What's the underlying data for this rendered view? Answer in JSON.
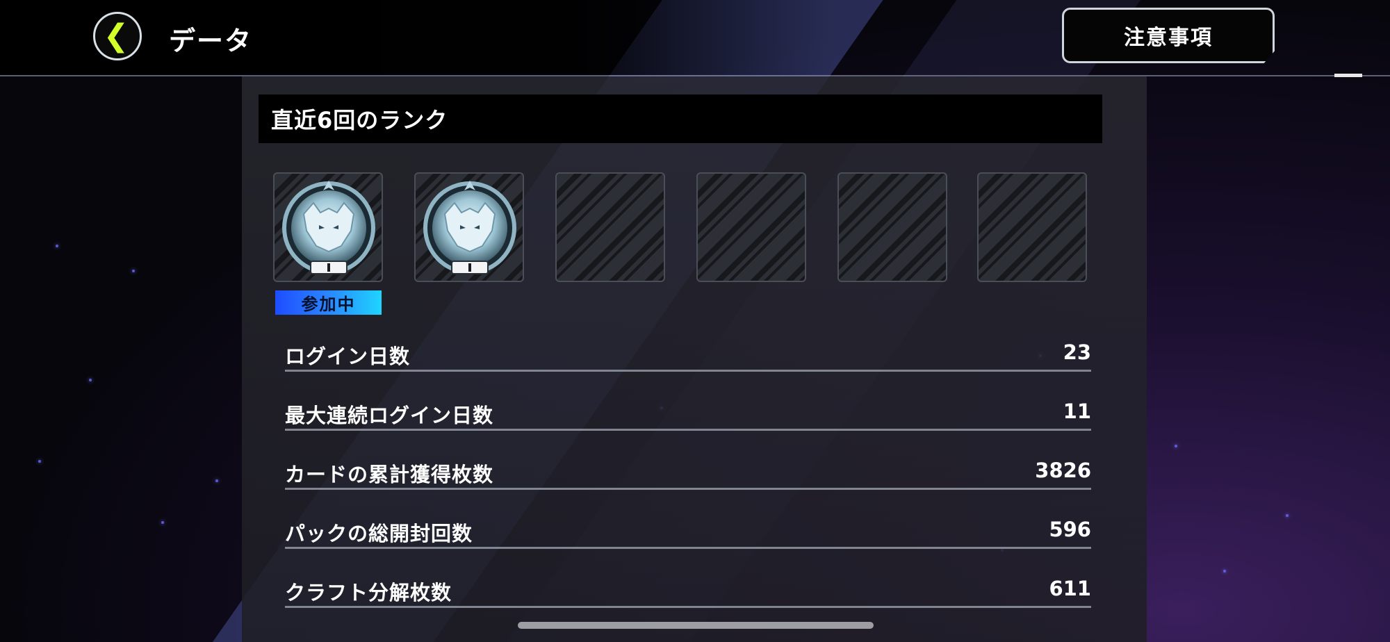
{
  "header": {
    "back_icon": "chevron-left-icon",
    "title": "データ",
    "notice_button": "注意事項"
  },
  "recent_ranks": {
    "title": "直近6回のランク",
    "slots": [
      {
        "state": "rank",
        "emblem": "wolf-rank-emblem",
        "tier": "I"
      },
      {
        "state": "rank",
        "emblem": "wolf-rank-emblem",
        "tier": "I"
      },
      {
        "state": "empty"
      },
      {
        "state": "empty"
      },
      {
        "state": "empty"
      },
      {
        "state": "empty"
      }
    ],
    "active_badge": "参加中"
  },
  "stats": [
    {
      "label": "ログイン日数",
      "value": "23"
    },
    {
      "label": "最大連続ログイン日数",
      "value": "11"
    },
    {
      "label": "カードの累計獲得枚数",
      "value": "3826"
    },
    {
      "label": "パックの総開封回数",
      "value": "596"
    },
    {
      "label": "クラフト分解枚数",
      "value": "611"
    }
  ],
  "colors": {
    "accent": "#d2ff2a",
    "badge_gradient_start": "#1e4dff",
    "badge_gradient_end": "#1fd4ff"
  }
}
